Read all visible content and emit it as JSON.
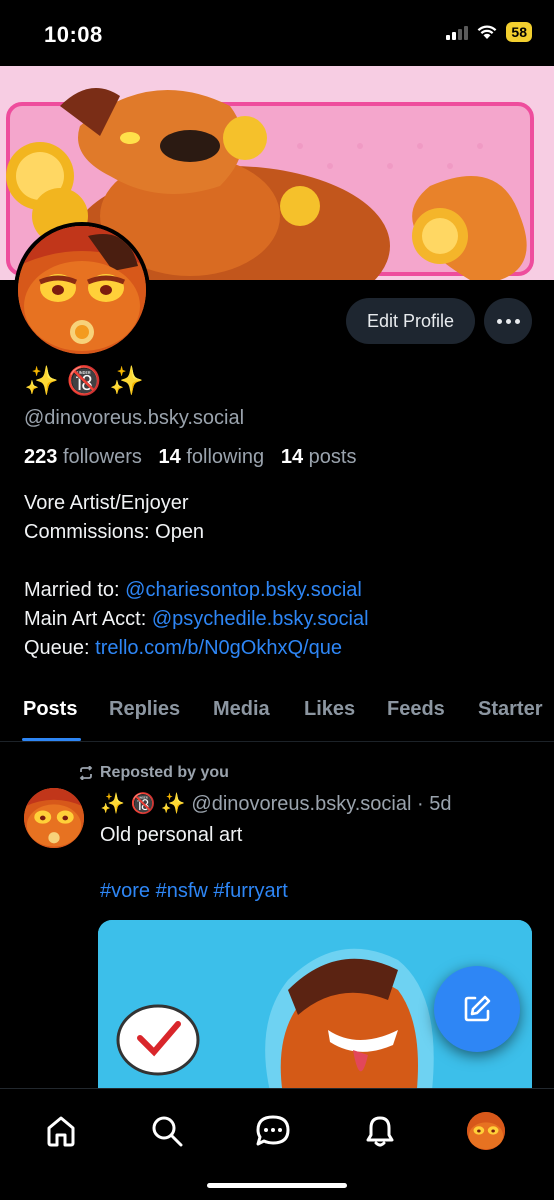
{
  "status_bar": {
    "time": "10:08",
    "battery": "58"
  },
  "profile": {
    "display_name": "✨ 🔞 ✨",
    "handle": "@dinovoreus.bsky.social",
    "edit_button": "Edit Profile",
    "stats": {
      "followers_count": "223",
      "followers_label": "followers",
      "following_count": "14",
      "following_label": "following",
      "posts_count": "14",
      "posts_label": "posts"
    },
    "bio": {
      "line1": "Vore Artist/Enjoyer",
      "line2": "Commissions: Open",
      "married_label": "Married to: ",
      "married_link": "@chariesontop.bsky.social",
      "main_art_label": "Main Art Acct: ",
      "main_art_link": "@psychedile.bsky.social",
      "queue_label": "Queue: ",
      "queue_link": "trello.com/b/N0gOkhxQ/que"
    }
  },
  "tabs": [
    "Posts",
    "Replies",
    "Media",
    "Likes",
    "Feeds",
    "Starter"
  ],
  "post": {
    "reposted_label": "Reposted by you",
    "author_name": "✨ 🔞 ✨",
    "author_handle": "@dinovoreus.bsky.social",
    "time": "5d",
    "text": "Old personal art",
    "tags": "#vore #nsfw #furryart"
  },
  "colors": {
    "accent": "#2e86f5",
    "background": "#000000",
    "muted_text": "#9aa3ad",
    "button_bg": "#1e2630"
  },
  "icons": {
    "nav": [
      "home-icon",
      "search-icon",
      "chat-icon",
      "bell-icon",
      "profile-avatar"
    ],
    "fab": "compose-icon",
    "more": "ellipsis-icon",
    "repost": "repost-icon"
  }
}
